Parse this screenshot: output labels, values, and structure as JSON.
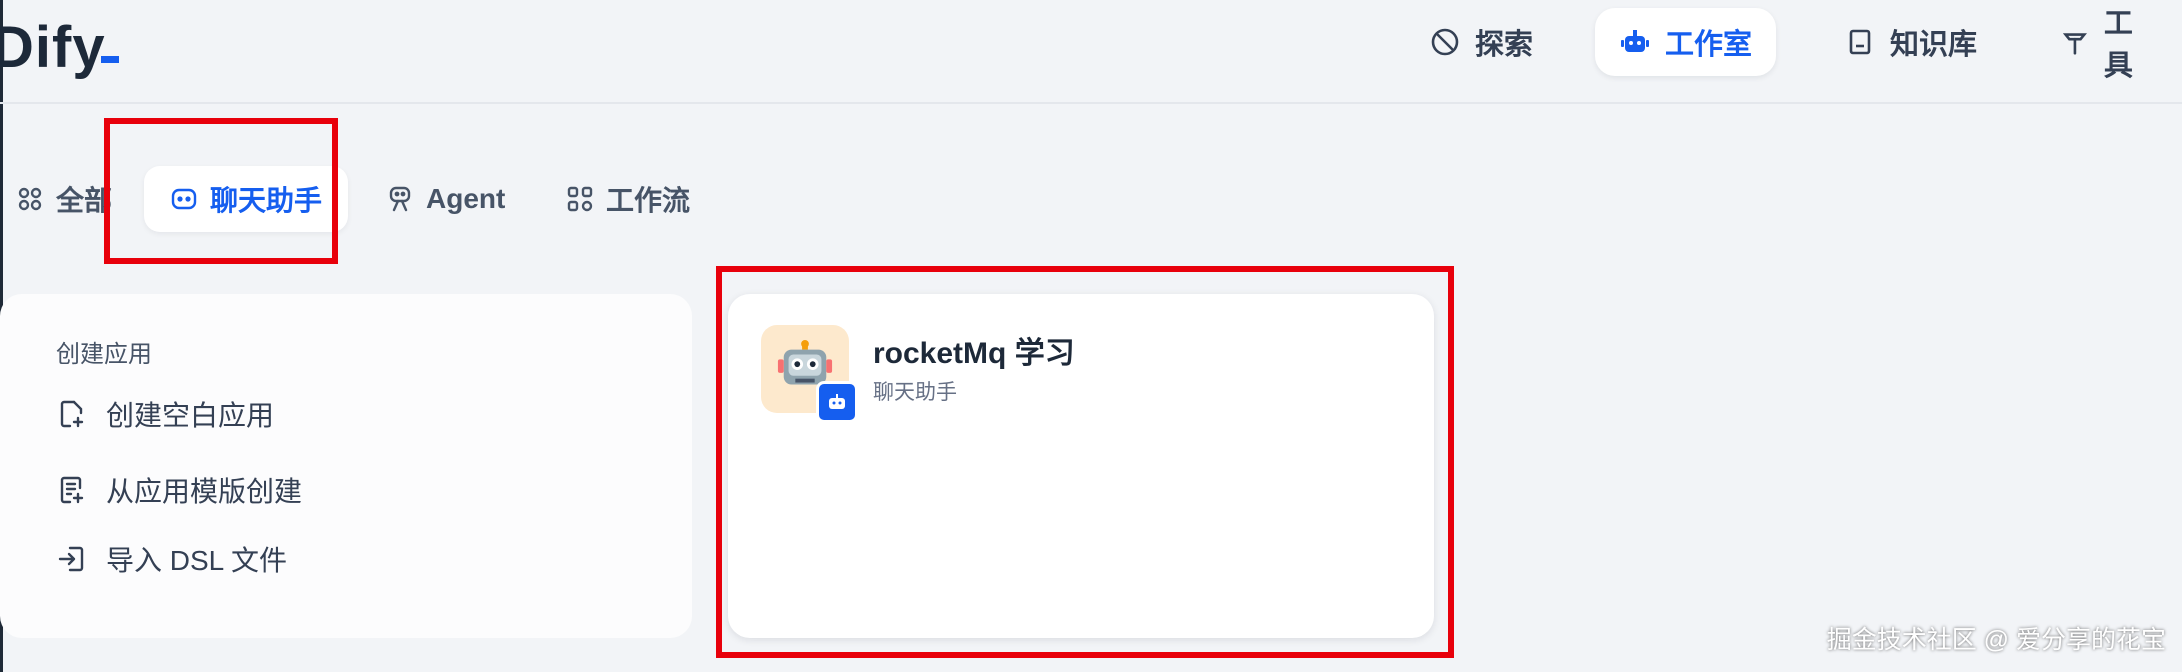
{
  "logo": {
    "text": "Dify"
  },
  "nav": {
    "explore": "探索",
    "studio": "工作室",
    "knowledge": "知识库",
    "tools": "工具"
  },
  "tabs": {
    "all": "全部",
    "chat": "聊天助手",
    "agent": "Agent",
    "workflow": "工作流"
  },
  "create": {
    "title": "创建应用",
    "blank": "创建空白应用",
    "template": "从应用模版创建",
    "import": "导入 DSL 文件"
  },
  "apps": [
    {
      "name": "rocketMq 学习",
      "type": "聊天助手",
      "icon": "robot-emoji",
      "badge": "chat-assistant-icon"
    }
  ],
  "watermark": "掘金技术社区 @ 爱分享的花宝",
  "colors": {
    "accent": "#155eef",
    "highlight": "#e8000b",
    "icon_bg": "#fde9cd"
  }
}
